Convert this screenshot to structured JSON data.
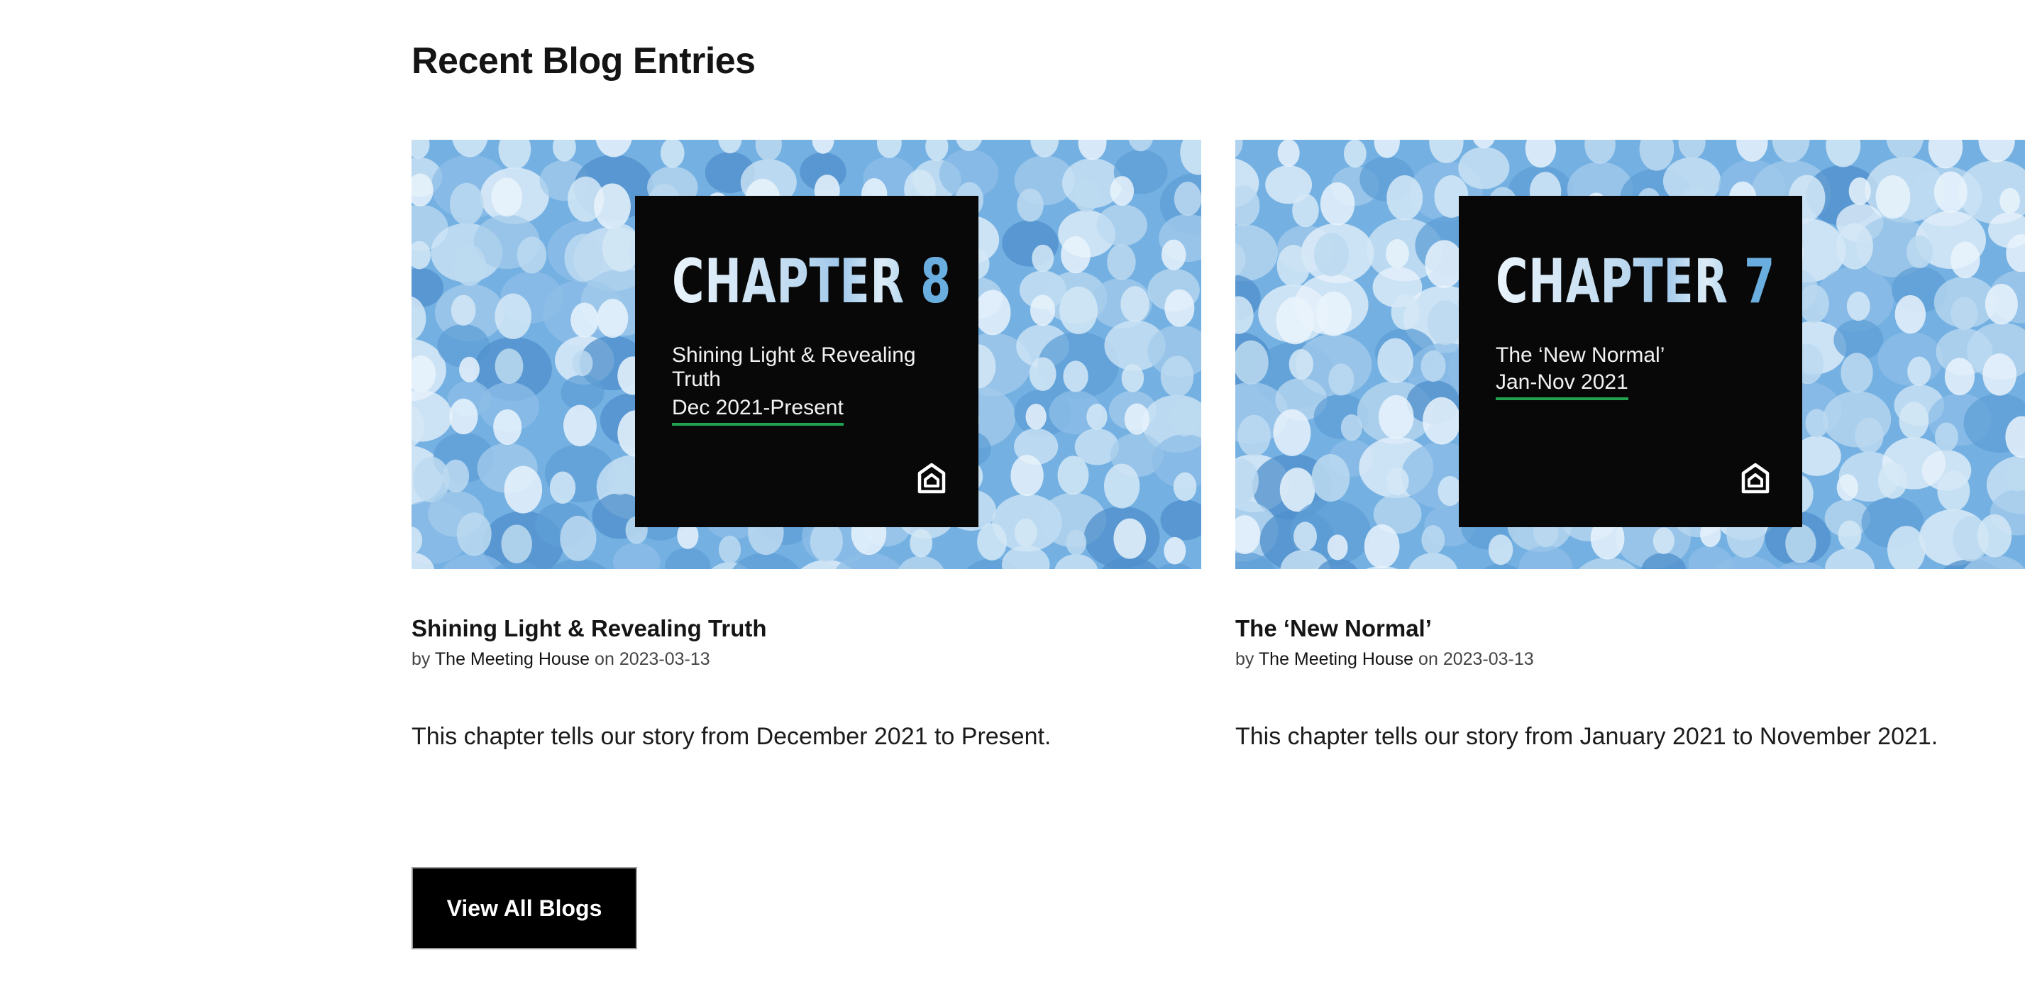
{
  "section": {
    "title": "Recent Blog Entries"
  },
  "posts": [
    {
      "poster": {
        "heading_word": "CHAPTER",
        "heading_num": "8",
        "subtitle": "Shining Light & Revealing Truth",
        "dates": "Dec 2021-Present",
        "logo_icon": "meeting-house-logo-icon"
      },
      "title": "Shining Light & Revealing Truth",
      "meta": {
        "by": "by",
        "author": "The Meeting House",
        "on": "on",
        "date": "2023-03-13"
      },
      "excerpt": "This chapter tells our story from December 2021 to Present."
    },
    {
      "poster": {
        "heading_word": "CHAPTER",
        "heading_num": "7",
        "subtitle": "The ‘New Normal’",
        "dates": "Jan-Nov 2021",
        "logo_icon": "meeting-house-logo-icon"
      },
      "title": "The ‘New Normal’",
      "meta": {
        "by": "by",
        "author": "The Meeting House",
        "on": "on",
        "date": "2023-03-13"
      },
      "excerpt": "This chapter tells our story from January 2021 to November 2021."
    }
  ],
  "view_all": {
    "label": "View All Blogs"
  },
  "colors": {
    "thumb_blue": "#74b1e2",
    "poster_black": "#080808",
    "underline_green": "#22a251",
    "button_black": "#000000"
  }
}
